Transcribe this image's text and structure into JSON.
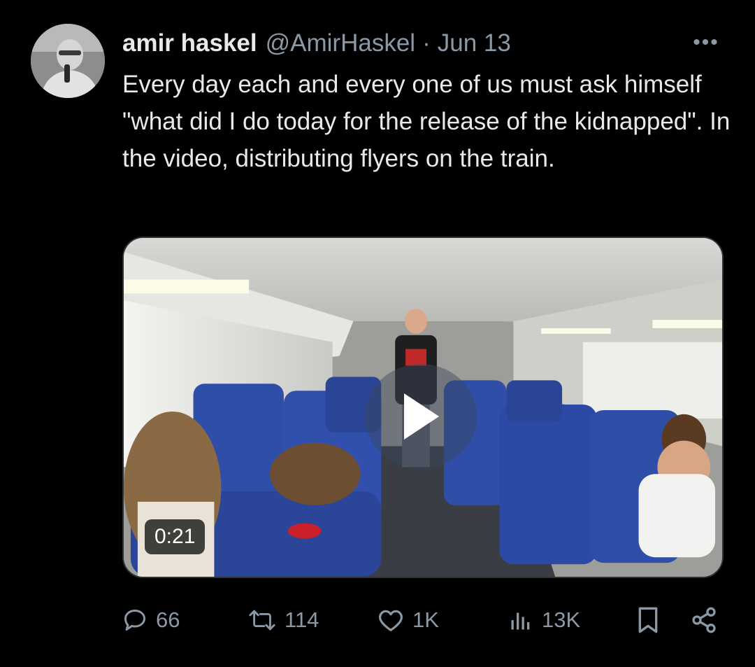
{
  "author": {
    "name": "amir haskel",
    "handle": "@AmirHaskel",
    "separator": "·",
    "date": "Jun 13"
  },
  "more_label": "•••",
  "tweet_text": "Every day each and every one of us must ask himself \"what did I do today for the release of the kidnapped\". In the video, distributing flyers on the train.",
  "media": {
    "duration": "0:21"
  },
  "actions": {
    "replies": "66",
    "reposts": "114",
    "likes": "1K",
    "views": "13K"
  },
  "icons": {
    "reply": "reply-icon",
    "repost": "repost-icon",
    "like": "heart-icon",
    "views": "views-icon",
    "bookmark": "bookmark-icon",
    "share": "share-icon",
    "play": "play-icon"
  },
  "colors": {
    "background": "#000000",
    "text": "#e7e9ea",
    "secondary": "#8b98a5",
    "seat_blue": "#2f4ea8"
  }
}
